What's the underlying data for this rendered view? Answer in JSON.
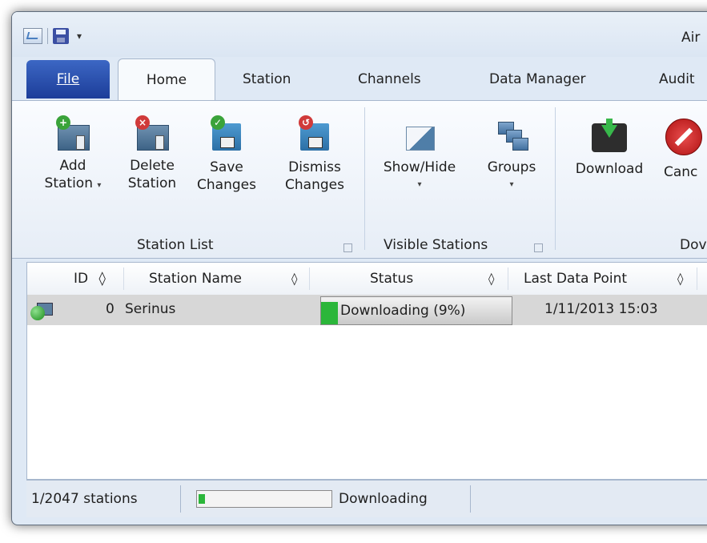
{
  "window": {
    "title": "Air"
  },
  "qat": {
    "more_glyph": "▾"
  },
  "tabs": {
    "file": "File",
    "home": "Home",
    "station": "Station",
    "channels": "Channels",
    "data_manager": "Data Manager",
    "audit": "Audit"
  },
  "ribbon": {
    "station_list": {
      "label": "Station List",
      "add": [
        "Add",
        "Station"
      ],
      "delete": [
        "Delete",
        "Station"
      ],
      "save": [
        "Save",
        "Changes"
      ],
      "dismiss": [
        "Dismiss",
        "Changes"
      ]
    },
    "visible_stations": {
      "label": "Visible Stations",
      "show_hide": "Show/Hide",
      "groups": "Groups"
    },
    "download_group": {
      "label": "Dov",
      "download": "Download",
      "cancel": "Canc"
    },
    "dropdown_glyph": "▾"
  },
  "grid": {
    "columns": [
      "ID",
      "Station Name",
      "Status",
      "Last Data Point"
    ],
    "sort_glyph": "◊",
    "rows": [
      {
        "id": "0",
        "name": "Serinus",
        "status": "Downloading (9%)",
        "progress": 0.09,
        "last_data_point": "1/11/2013 15:03"
      }
    ]
  },
  "statusbar": {
    "stations": "1/2047 stations",
    "progress": 0.05,
    "state": "Downloading"
  },
  "colors": {
    "accent": "#2bb63a",
    "file_tab": "#1c3d99"
  }
}
